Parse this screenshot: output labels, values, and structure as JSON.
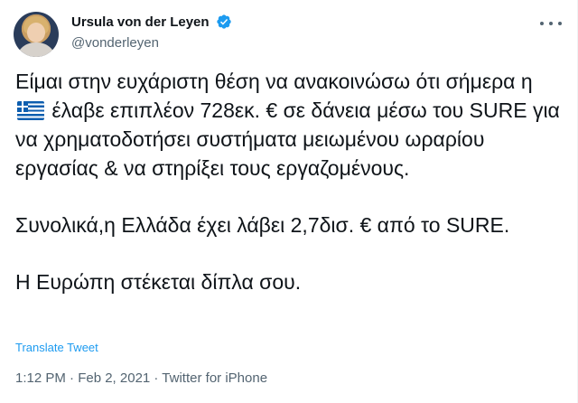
{
  "author": {
    "display_name": "Ursula von der Leyen",
    "handle": "@vonderleyen",
    "verified": true,
    "avatar_icon": "profile-photo"
  },
  "tweet": {
    "paragraphs": [
      {
        "before_flag": "Είμαι στην ευχάριστη θέση να ανακοινώσω ότι σήμερα η ",
        "flag_icon": "greece-flag-emoji",
        "after_flag": " έλαβε επιπλέον 728εκ. € σε δάνεια μέσω του SURE για να χρηματοδοτήσει συστήματα μειωμένου ωραρίου εργασίας & να στηρίξει τους εργαζομένους."
      },
      {
        "text": "Συνολικά,η Ελλάδα έχει λάβει 2,7δισ. € από το SURE."
      },
      {
        "text": "Η Ευρώπη στέκεται δίπλα σου."
      }
    ],
    "translate_label": "Translate Tweet",
    "timestamp": "1:12 PM · Feb 2, 2021 · Twitter for iPhone"
  },
  "colors": {
    "text": "#0f1419",
    "secondary": "#536471",
    "link": "#1d9bf0",
    "verified": "#1d9bf0",
    "flag_blue": "#0d5eaf"
  }
}
